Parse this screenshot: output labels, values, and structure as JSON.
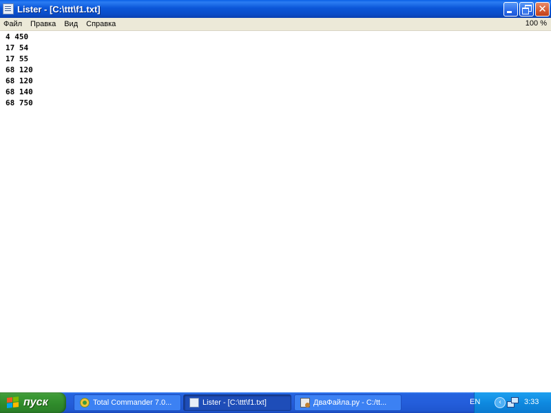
{
  "window": {
    "title": "Lister - [C:\\ttt\\f1.txt]"
  },
  "menu": {
    "items": [
      "Файл",
      "Правка",
      "Вид",
      "Справка"
    ],
    "zoom": "100 %"
  },
  "file_lines": [
    "4 450",
    "17 54",
    "17 55",
    "68 120",
    "68 120",
    "68 140",
    "68 750"
  ],
  "taskbar": {
    "start_label": "пуск",
    "tasks": [
      {
        "label": "Total Commander 7.0...",
        "active": false
      },
      {
        "label": "Lister - [C:\\ttt\\f1.txt]",
        "active": true
      },
      {
        "label": "ДваФайла.py - C:/tt...",
        "active": false
      }
    ],
    "language": "EN",
    "clock": "3:33"
  },
  "colors": {
    "titlebar": "#0a4cc8",
    "menubar": "#ece9d8",
    "taskbar": "#245edb",
    "start_button": "#3c9a35",
    "tray": "#0f8ae0"
  }
}
